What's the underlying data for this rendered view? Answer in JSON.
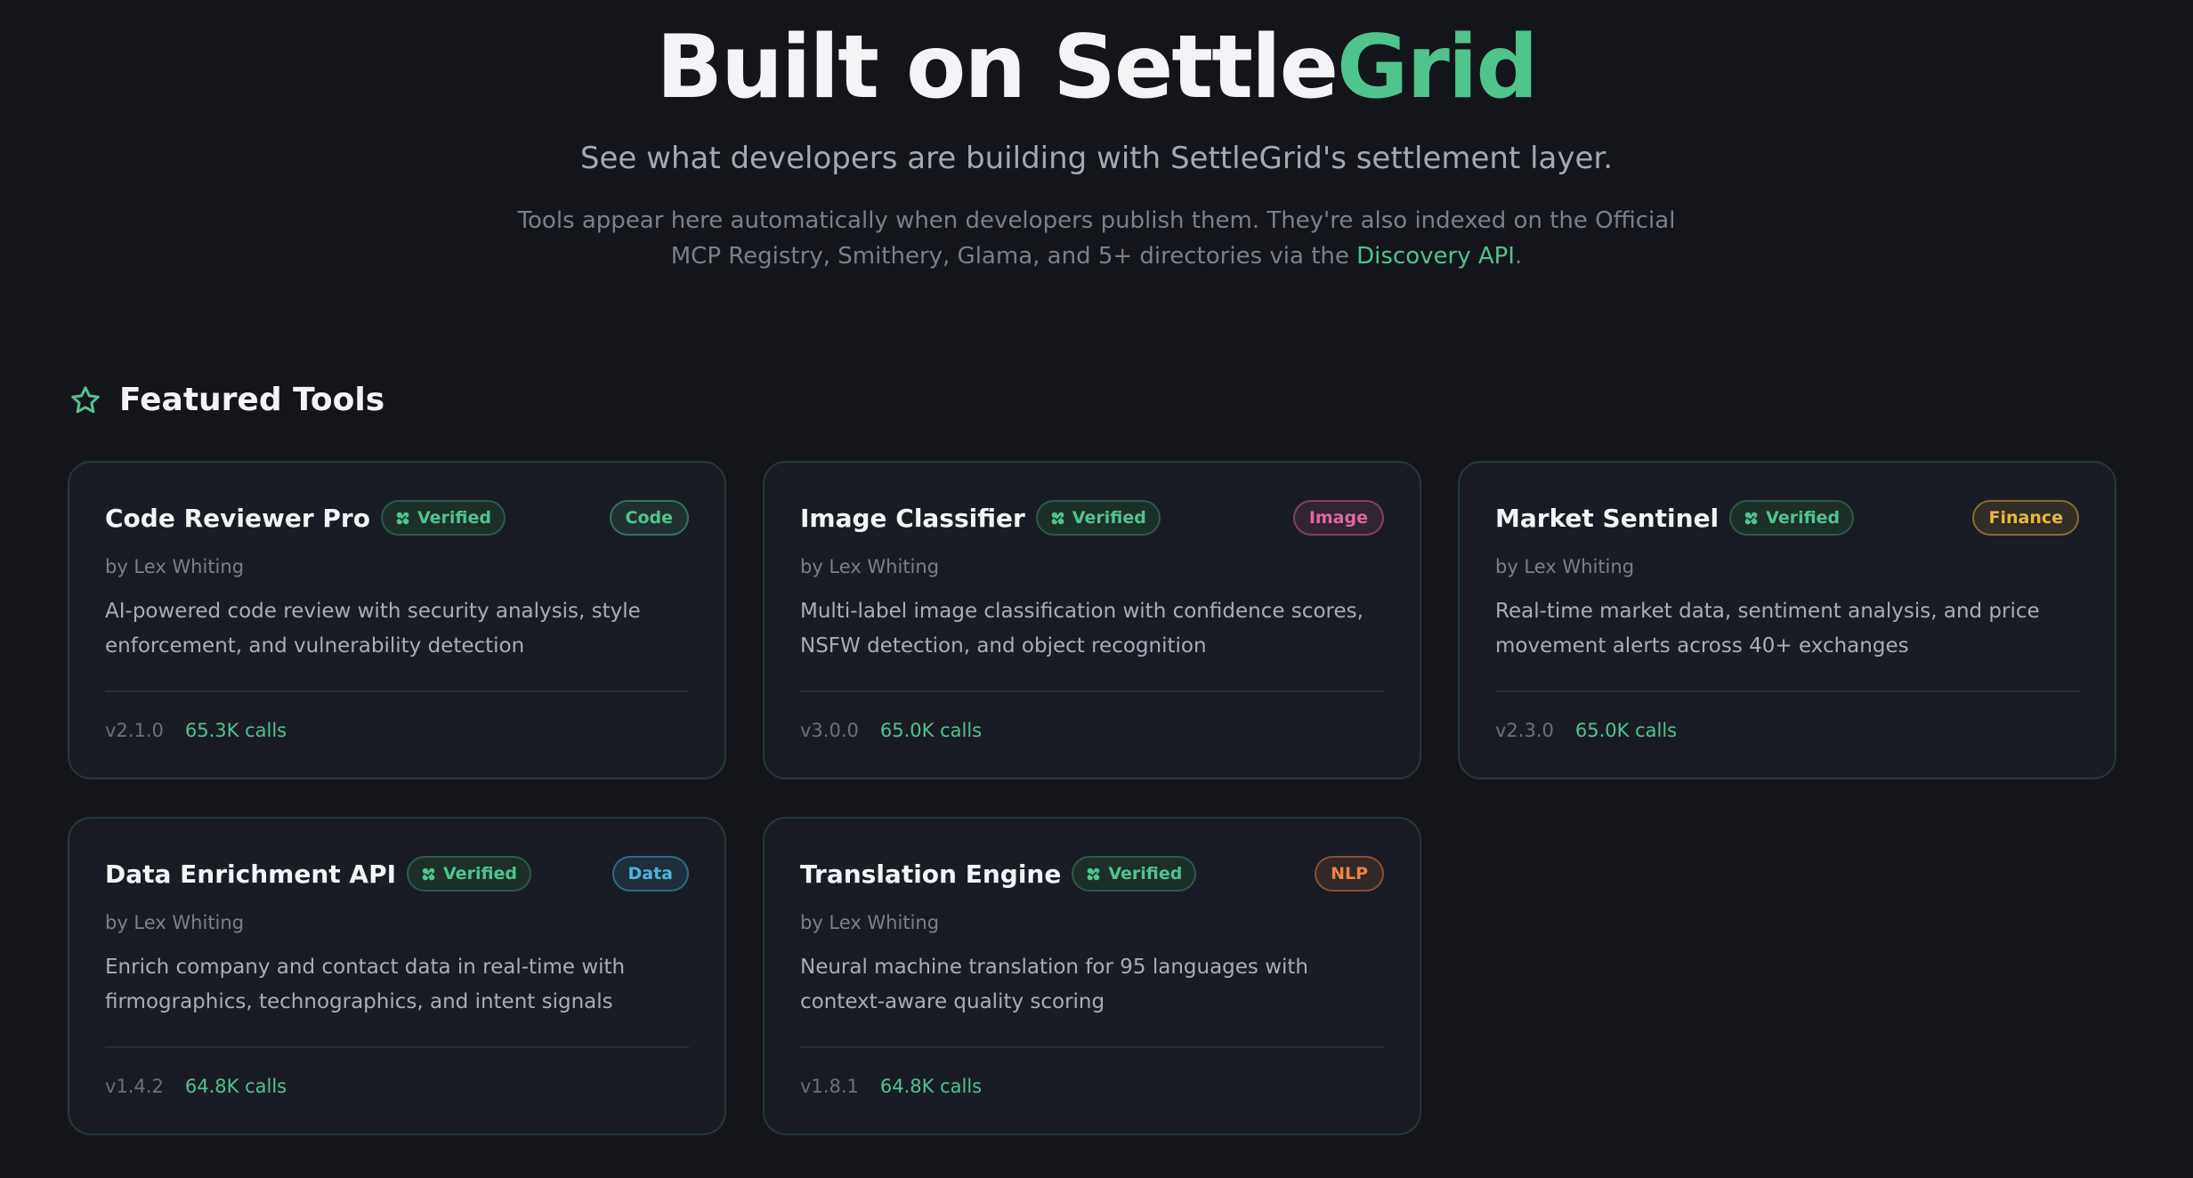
{
  "hero": {
    "title_main": "Built on Settle",
    "title_accent": "Grid",
    "subtitle": "See what developers are building with SettleGrid's settlement layer.",
    "description_before_link": "Tools appear here automatically when developers publish them. They're also indexed on the Official MCP Registry, Smithery, Glama, and 5+ directories via the ",
    "description_link": "Discovery API",
    "description_after_link": "."
  },
  "featured": {
    "heading": "Featured Tools",
    "icon": "star-icon",
    "verified_label": "Verified",
    "tools": [
      {
        "name": "Code Reviewer Pro",
        "category": "Code",
        "category_color": "#4fc48d",
        "author": "by Lex Whiting",
        "description": "AI-powered code review with security analysis, style enforcement, and vulnerability detection",
        "version": "v2.1.0",
        "calls": "65.3K calls"
      },
      {
        "name": "Image Classifier",
        "category": "Image",
        "category_color": "#e0679f",
        "author": "by Lex Whiting",
        "description": "Multi-label image classification with confidence scores, NSFW detection, and object recognition",
        "version": "v3.0.0",
        "calls": "65.0K calls"
      },
      {
        "name": "Market Sentinel",
        "category": "Finance",
        "category_color": "#e8b93c",
        "author": "by Lex Whiting",
        "description": "Real-time market data, sentiment analysis, and price movement alerts across 40+ exchanges",
        "version": "v2.3.0",
        "calls": "65.0K calls"
      },
      {
        "name": "Data Enrichment API",
        "category": "Data",
        "category_color": "#4eb3de",
        "author": "by Lex Whiting",
        "description": "Enrich company and contact data in real-time with firmographics, technographics, and intent signals",
        "version": "v1.4.2",
        "calls": "64.8K calls"
      },
      {
        "name": "Translation Engine",
        "category": "NLP",
        "category_color": "#ee8540",
        "author": "by Lex Whiting",
        "description": "Neural machine translation for 95 languages with context-aware quality scoring",
        "version": "v1.8.1",
        "calls": "64.8K calls"
      }
    ]
  },
  "colors": {
    "background": "#14151b",
    "accent": "#4fc48d",
    "card_background": "#1a1c25",
    "card_border": "#233b35"
  }
}
